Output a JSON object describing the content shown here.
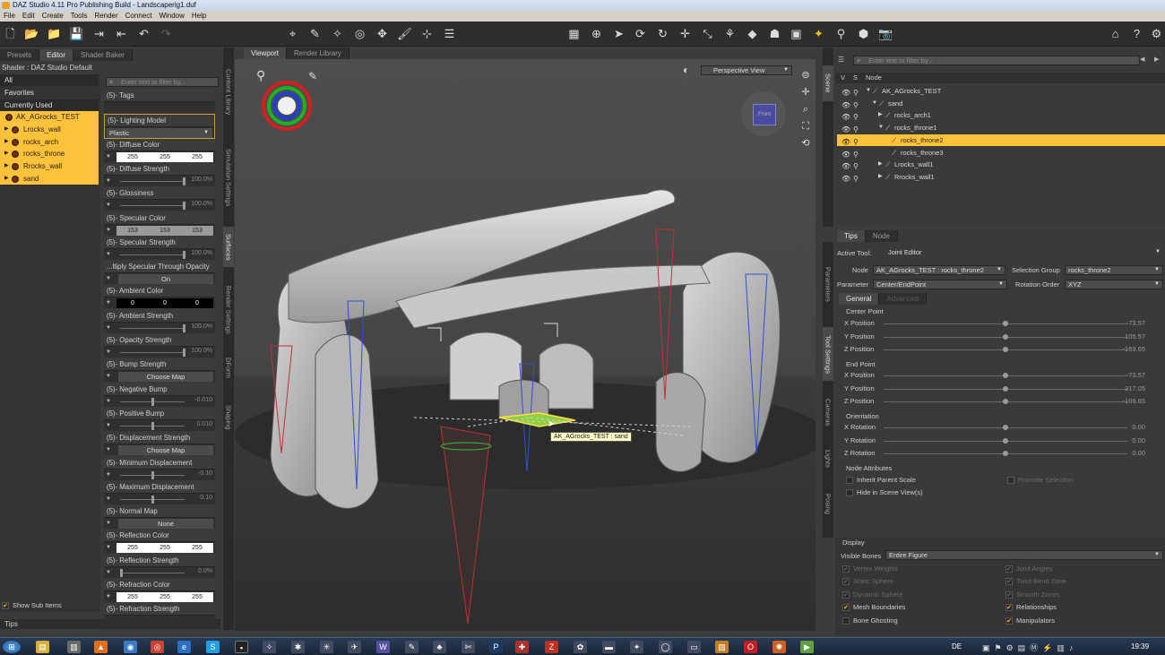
{
  "window": {
    "title": "DAZ Studio 4.11 Pro Publishing Build - Landscaperig1.duf"
  },
  "menu": [
    "File",
    "Edit",
    "Create",
    "Tools",
    "Render",
    "Connect",
    "Window",
    "Help"
  ],
  "left_panel": {
    "tabs": [
      "Presets",
      "Editor",
      "Shader Baker"
    ],
    "shader_label": "Shader : DAZ Studio Default",
    "filter_placeholder": "Enter text to filter by...",
    "categories": [
      "All",
      "Favorites",
      "Currently Used"
    ],
    "objects": [
      "AK_AGrocks_TEST",
      "Lrocks_wall",
      "rocks_arch",
      "rocks_throne",
      "Rrocks_wall",
      "sand"
    ],
    "show_sub_items": "Show Sub Items",
    "tips": "Tips",
    "properties": [
      {
        "label": "(5)- Tags",
        "kind": "blank"
      },
      {
        "label": "(5)- Lighting Model",
        "kind": "select",
        "value": "Plastic"
      },
      {
        "label": "(5)- Diffuse Color",
        "kind": "rgb",
        "rgb": [
          "255",
          "255",
          "255"
        ],
        "bg": "#ffffff"
      },
      {
        "label": "(5)- Diffuse Strength",
        "kind": "slider",
        "value": "100.0%",
        "pos": 1.0
      },
      {
        "label": "(5)- Glossiness",
        "kind": "slider",
        "value": "100.0%",
        "pos": 1.0
      },
      {
        "label": "(5)- Specular Color",
        "kind": "rgb",
        "rgb": [
          "153",
          "153",
          "153"
        ],
        "bg": "#999999"
      },
      {
        "label": "(5)- Specular Strength",
        "kind": "slider",
        "value": "100.0%",
        "pos": 1.0
      },
      {
        "label": "...ltiply Specular Through Opacity",
        "kind": "button",
        "value": "On"
      },
      {
        "label": "(5)- Ambient Color",
        "kind": "rgb",
        "rgb": [
          "0",
          "0",
          "0"
        ],
        "bg": "#000000",
        "fg": "#ffffff"
      },
      {
        "label": "(5)- Ambient Strength",
        "kind": "slider",
        "value": "100.0%",
        "pos": 1.0
      },
      {
        "label": "(5)- Opacity Strength",
        "kind": "slider",
        "value": "100.0%",
        "pos": 1.0
      },
      {
        "label": "(5)- Bump Strength",
        "kind": "button",
        "value": "Choose Map"
      },
      {
        "label": "(5)- Negative Bump",
        "kind": "slider",
        "value": "-0.010",
        "pos": 0.5
      },
      {
        "label": "(5)- Positive Bump",
        "kind": "slider",
        "value": "0.010",
        "pos": 0.5
      },
      {
        "label": "(5)- Displacement Strength",
        "kind": "button",
        "value": "Choose Map"
      },
      {
        "label": "(5)- Minimum Displacement",
        "kind": "slider",
        "value": "-0.10",
        "pos": 0.5
      },
      {
        "label": "(5)- Maximum Displacement",
        "kind": "slider",
        "value": "0.10",
        "pos": 0.5
      },
      {
        "label": "(5)- Normal Map",
        "kind": "button",
        "value": "None"
      },
      {
        "label": "(5)- Reflection Color",
        "kind": "rgb",
        "rgb": [
          "255",
          "255",
          "255"
        ],
        "bg": "#ffffff"
      },
      {
        "label": "(5)- Reflection Strength",
        "kind": "slider",
        "value": "0.0%",
        "pos": 0.0
      },
      {
        "label": "(5)- Refraction Color",
        "kind": "rgb",
        "rgb": [
          "255",
          "255",
          "255"
        ],
        "bg": "#ffffff"
      },
      {
        "label": "(5)- Refraction Strength",
        "kind": "blank"
      }
    ]
  },
  "side_tabs_left": [
    "Content Library",
    "Simulation Settings",
    "Surfaces",
    "Render Settings",
    "DForm",
    "Shaping"
  ],
  "side_tabs_right": [
    "Parameters",
    "Tool Settings",
    "Cameras",
    "Lights",
    "Posing"
  ],
  "viewport": {
    "tabs": [
      "Viewport",
      "Render Library"
    ],
    "view_mode": "Perspective View",
    "cube_label": "Front",
    "tooltip": "AK_AGrocks_TEST : sand"
  },
  "scene": {
    "filter_placeholder": "Enter text to filter by...",
    "headers": [
      "V",
      "S",
      "Node"
    ],
    "nodes": [
      {
        "name": "AK_AGrocks_TEST",
        "depth": 0,
        "tri": "▼"
      },
      {
        "name": "sand",
        "depth": 1,
        "tri": "▼"
      },
      {
        "name": "rocks_arch1",
        "depth": 2,
        "tri": "▶"
      },
      {
        "name": "rocks_throne1",
        "depth": 2,
        "tri": "▼"
      },
      {
        "name": "rocks_throne2",
        "depth": 3,
        "tri": "",
        "selected": true
      },
      {
        "name": "rocks_throne3",
        "depth": 3,
        "tri": ""
      },
      {
        "name": "Lrocks_wall1",
        "depth": 2,
        "tri": "▶"
      },
      {
        "name": "Rrocks_wall1",
        "depth": 2,
        "tri": "▶"
      }
    ]
  },
  "tool": {
    "tabs": [
      "Tips",
      "Node"
    ],
    "active_tool_label": "Active Tool:",
    "active_tool": "Joint Editor",
    "node_label": "Node",
    "node_value": "AK_AGrocks_TEST : rocks_throne2",
    "selection_group_label": "Selection Group",
    "selection_group_value": "rocks_throne2",
    "parameter_label": "Parameter",
    "parameter_value": "Center/EndPoint",
    "rotation_order_label": "Rotation Order",
    "rotation_order_value": "XYZ",
    "subtabs": [
      "General",
      "Advanced"
    ],
    "center_point_label": "Center Point",
    "center_point": [
      {
        "label": "X Position",
        "value": "-73.57",
        "pos": 0.5
      },
      {
        "label": "Y Position",
        "value": "105.57",
        "pos": 0.5
      },
      {
        "label": "Z Position",
        "value": "-169.65",
        "pos": 0.5
      }
    ],
    "end_point_label": "End Point",
    "end_point": [
      {
        "label": "X Position",
        "value": "-73.57",
        "pos": 0.5
      },
      {
        "label": "Y Position",
        "value": "317.05",
        "pos": 0.5
      },
      {
        "label": "Z Position",
        "value": "-169.65",
        "pos": 0.5
      }
    ],
    "orientation_label": "Orientation",
    "orientation": [
      {
        "label": "X Rotation",
        "value": "0.00",
        "pos": 0.5
      },
      {
        "label": "Y Rotation",
        "value": "0.00",
        "pos": 0.5
      },
      {
        "label": "Z Rotation",
        "value": "0.00",
        "pos": 0.5
      }
    ],
    "node_attributes_label": "Node Attributes",
    "inherit_parent_scale": "Inherit Parent Scale",
    "promote_selection": "Promote Selection",
    "hide_in_scene_view": "Hide in Scene View(s)",
    "display_label": "Display",
    "visible_bones_label": "Visible Bones",
    "visible_bones_value": "Entire Figure",
    "display_options": [
      {
        "label": "Vertex Weights",
        "checked": true,
        "disabled": true
      },
      {
        "label": "Joint Angles",
        "checked": true,
        "disabled": true
      },
      {
        "label": "Static Sphere",
        "checked": true,
        "disabled": true
      },
      {
        "label": "Twist Bend Zone",
        "checked": true,
        "disabled": true
      },
      {
        "label": "Dynamic Sphere",
        "checked": true,
        "disabled": true
      },
      {
        "label": "Smooth Zones",
        "checked": true,
        "disabled": true
      },
      {
        "label": "Mesh Boundaries",
        "checked": true,
        "disabled": false
      },
      {
        "label": "Relationships",
        "checked": true,
        "disabled": false
      },
      {
        "label": "Bone Ghosting",
        "checked": false,
        "disabled": false
      },
      {
        "label": "Manipulators",
        "checked": true,
        "disabled": false
      }
    ]
  },
  "taskbar": {
    "lang": "DE",
    "clock": "19:39"
  },
  "colors": {
    "accent": "#ffc23a",
    "panel": "#3a3a3a"
  }
}
